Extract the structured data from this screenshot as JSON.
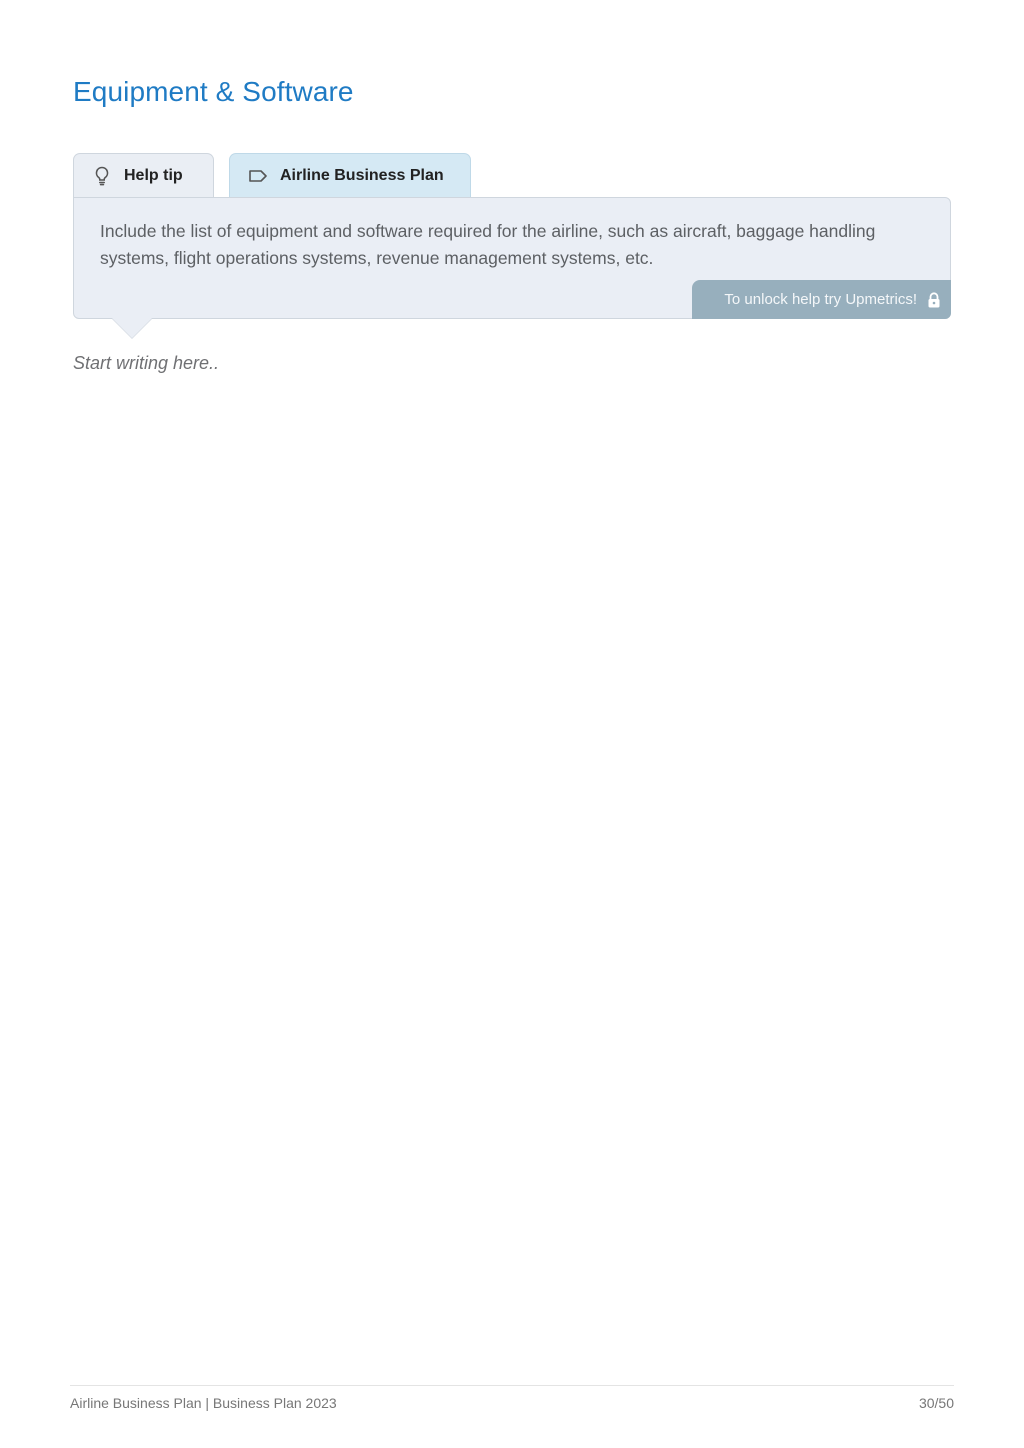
{
  "page": {
    "title": "Equipment & Software",
    "placeholder": "Start writing here.."
  },
  "tabs": [
    {
      "label": "Help tip",
      "icon": "lightbulb-icon"
    },
    {
      "label": "Airline Business Plan",
      "icon": "tag-icon"
    }
  ],
  "tip": {
    "text": "Include the list of equipment and software required for the airline, such as aircraft, baggage handling systems, flight operations systems, revenue management systems, etc.",
    "unlock_label": "To unlock help try Upmetrics!",
    "unlock_icon": "lock-icon"
  },
  "footer": {
    "left": "Airline Business Plan | Business Plan 2023",
    "page_number": "30/50"
  },
  "colors": {
    "title": "#1f7bc4",
    "help_tab_bg": "#eaeef4",
    "plan_tab_bg": "#d5e9f4",
    "tip_bg": "#eaeef5",
    "unlock_bg": "#97afbd"
  }
}
